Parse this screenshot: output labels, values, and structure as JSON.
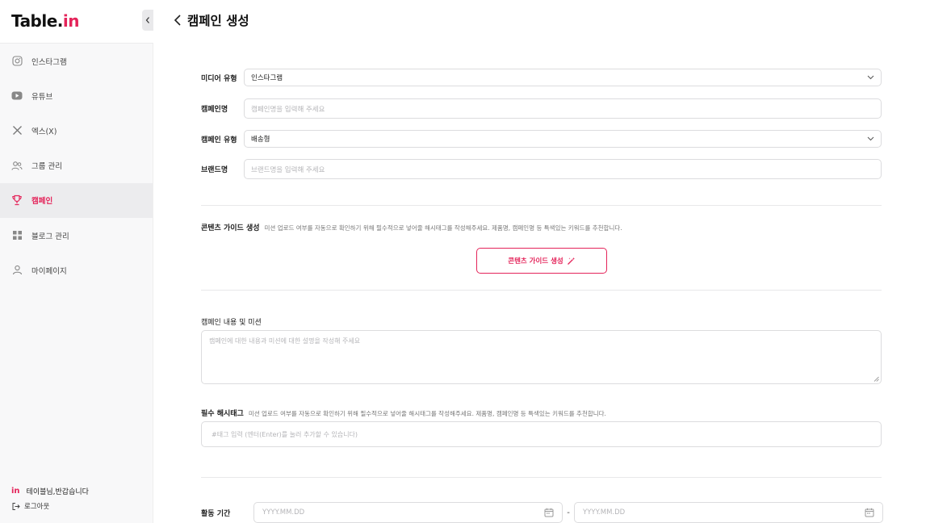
{
  "brand": {
    "logo_main": "Table.",
    "logo_accent": "in",
    "accent_color": "#e4245a"
  },
  "sidebar": {
    "items": [
      {
        "label": "인스타그램",
        "icon": "instagram-icon",
        "active": false
      },
      {
        "label": "유튜브",
        "icon": "youtube-icon",
        "active": false
      },
      {
        "label": "엑스(X)",
        "icon": "x-icon",
        "active": false
      },
      {
        "label": "그룹 관리",
        "icon": "group-icon",
        "active": false
      },
      {
        "label": "캠페인",
        "icon": "trophy-icon",
        "active": true
      },
      {
        "label": "블로그 관리",
        "icon": "grid-icon",
        "active": false
      },
      {
        "label": "마이페이지",
        "icon": "user-icon",
        "active": false
      }
    ],
    "greeting_logo": "in",
    "greeting": "테이블님,반갑습니다",
    "logout": "로그아웃"
  },
  "page": {
    "title": "캠페인 생성"
  },
  "form": {
    "media_type": {
      "label": "미디어 유형",
      "value": "인스타그램"
    },
    "campaign_name": {
      "label": "캠페인명",
      "placeholder": "캠페인명을 입력해 주세요"
    },
    "campaign_type": {
      "label": "캠페인 유형",
      "value": "배송형"
    },
    "brand_name": {
      "label": "브랜드명",
      "placeholder": "브랜드명을 입력해 주세요"
    },
    "content_guide": {
      "title": "콘텐츠 가이드 생성",
      "description": "미션 업로드 여부를 자동으로 확인하기 위해 필수적으로 넣어줄 해시태그를 작성해주세요. 제품명, 캠페인명 등 특색있는 키워드를 추천합니다.",
      "button": "콘텐츠 가이드 생성"
    },
    "mission": {
      "label": "캠페인 내용 및 미션",
      "placeholder": "캠페인에 대한 내용과 미션에 대한 설명을 작성해 주세요"
    },
    "hashtags": {
      "title": "필수 해시태그",
      "description": "미션 업로드 여부를 자동으로 확인하기 위해 필수적으로 넣어줄 해시태그를 작성해주세요. 제품명, 캠페인명 등 특색있는 키워드를 추천합니다.",
      "placeholder": "#태그 입력 (엔터(Enter)를 눌러 추가할 수 있습니다)"
    },
    "period": {
      "label": "활동 기간",
      "start_placeholder": "YYYY.MM.DD",
      "separator": "-",
      "end_placeholder": "YYYY.MM.DD"
    }
  }
}
